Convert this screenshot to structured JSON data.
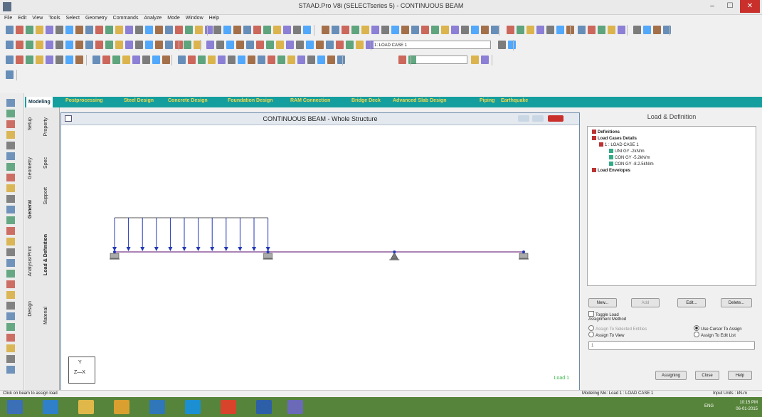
{
  "window": {
    "title": "STAAD.Pro V8i (SELECTseries 5) - CONTINUOUS BEAM",
    "minimize": "–",
    "maximize": "☐",
    "close": "✕"
  },
  "menu": [
    "File",
    "Edit",
    "View",
    "Tools",
    "Select",
    "Geometry",
    "Commands",
    "Analyze",
    "Mode",
    "Window",
    "Help"
  ],
  "toolbar": {
    "load_case_combo": "1: LOAD CASE 1"
  },
  "page_tabs": [
    {
      "label": "Modeling",
      "active": true
    },
    {
      "label": "Postprocessing"
    },
    {
      "label": "Steel Design"
    },
    {
      "label": "Concrete Design"
    },
    {
      "label": "Foundation Design"
    },
    {
      "label": "RAM Connection"
    },
    {
      "label": "Bridge Deck"
    },
    {
      "label": "Advanced Slab Design"
    },
    {
      "label": "Piping"
    },
    {
      "label": "Earthquake"
    }
  ],
  "vertical_pages": {
    "setup": "Setup",
    "geometry": "Geometry",
    "general": "General",
    "analysis_print": "Analysis/Print",
    "design": "Design",
    "property": "Property",
    "spec": "Spec",
    "support": "Support",
    "load_definition": "Load & Definition",
    "material": "Material"
  },
  "view": {
    "title": "CONTINUOUS BEAM - Whole Structure",
    "load_label": "Load 1",
    "axis_y": "Y",
    "axis_zx": "Z—X"
  },
  "panel": {
    "title": "Load & Definition",
    "tree": {
      "definitions": "Definitions",
      "load_cases_details": "Load Cases Details",
      "load_case_1": "1 : LOAD CASE 1",
      "load_items": [
        "UNI GY -2kN/m",
        "CON GY -5.2kN/m",
        "CON GY -8.2.5kN/m"
      ],
      "load_envelopes": "Load Envelopes"
    },
    "buttons": {
      "new": "New...",
      "add": "Add",
      "edit": "Edit...",
      "delete": "Delete..."
    },
    "toggle_load": "Toggle Load",
    "assignment_method": "Assignment Method",
    "assign_selected": "Assign To Selected Entities",
    "use_cursor": "Use Cursor To Assign",
    "assign_view": "Assign To View",
    "assign_edit_list": "Assign To Edit List",
    "edit_list_value": "1",
    "assigning": "Assigning",
    "close": "Close",
    "help": "Help"
  },
  "status": {
    "left": "Click on beam to assign load",
    "middle": "Modeling Mo: Load 1 : LOAD CASE 1",
    "right": "Input Units : kN-m"
  },
  "taskbar": {
    "lang": "ENG",
    "time": "10:15 PM",
    "date": "06-01-2015"
  },
  "structure": {
    "udl_span_fraction": [
      0.0,
      0.375
    ],
    "arrow_count": 12,
    "support_positions_fraction": [
      0.0,
      0.375,
      0.684,
      1.0
    ],
    "support_types": [
      "fixed",
      "fixed",
      "pinned",
      "fixed"
    ]
  },
  "colors": {
    "tab_bar": "#159e9e",
    "tab_text": "#f2d94a",
    "load_arrows": "#2438b8",
    "load_label": "#3ab84a",
    "taskbar": "#56843a",
    "close_button": "#c9302c"
  }
}
